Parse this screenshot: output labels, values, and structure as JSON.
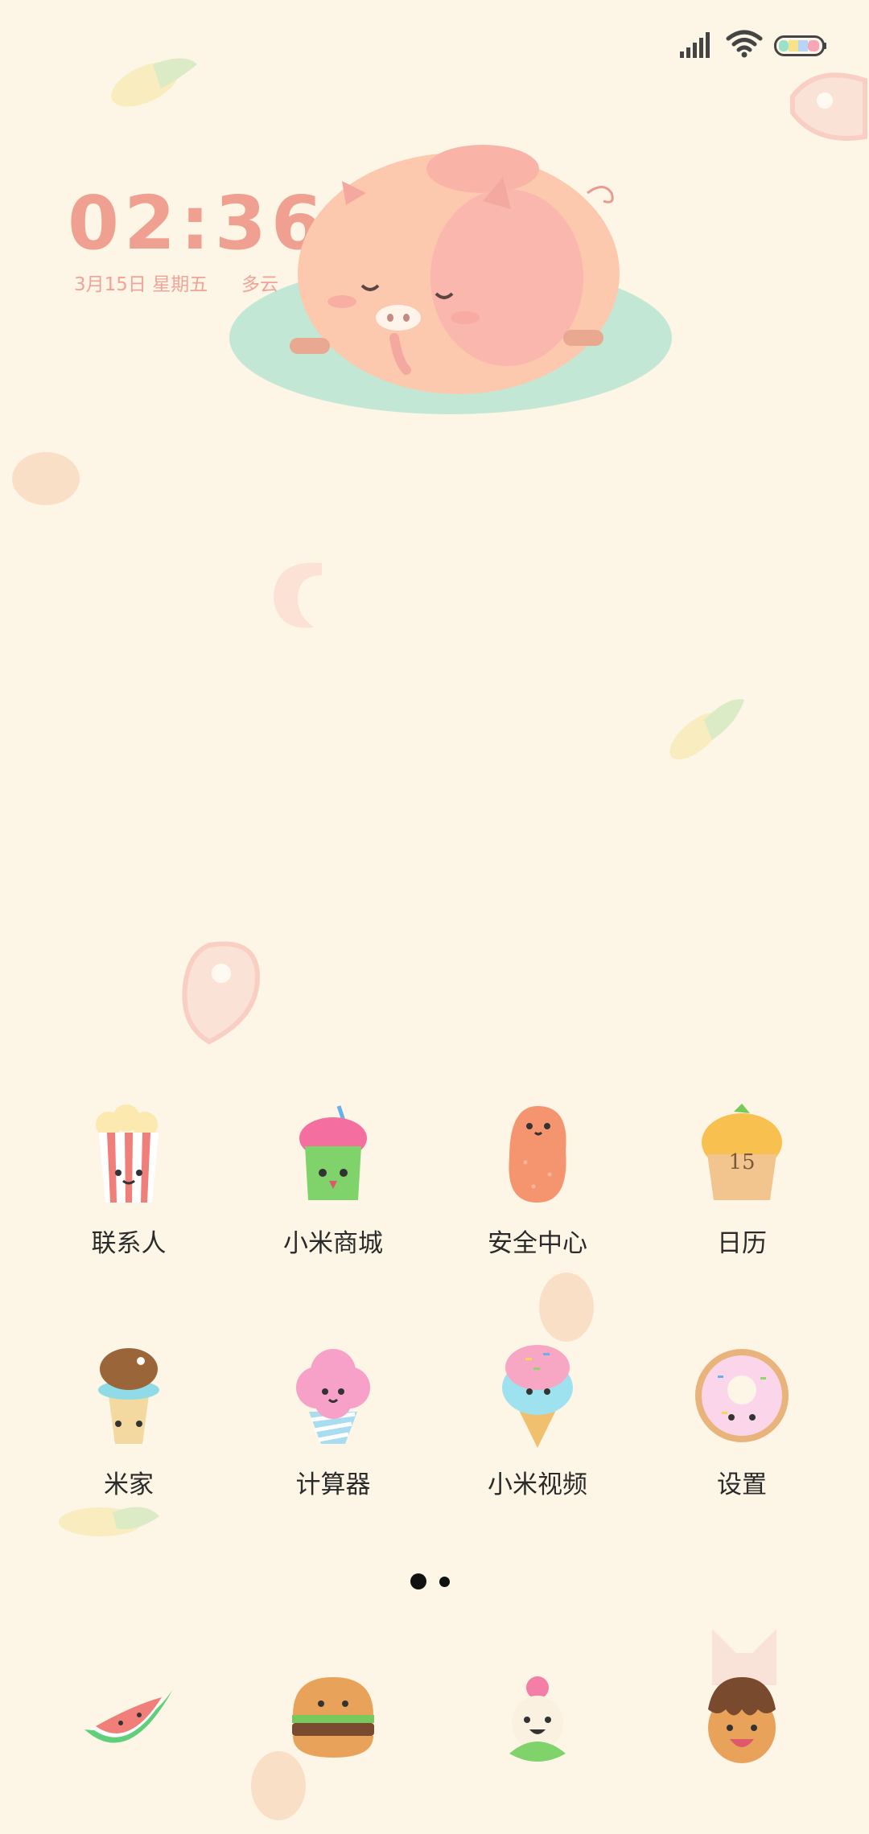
{
  "status_bar": {
    "signal_icon": "signal-bars-icon",
    "wifi_icon": "wifi-icon",
    "battery_icon": "battery-icon"
  },
  "clock": {
    "time": "02:36",
    "date": "3月15日 星期五",
    "weather": "多云"
  },
  "apps": [
    {
      "label": "联系人",
      "icon": "popcorn-icon"
    },
    {
      "label": "小米商城",
      "icon": "cupcake-icon"
    },
    {
      "label": "安全中心",
      "icon": "bean-icon"
    },
    {
      "label": "日历",
      "icon": "calendar-cupcake-icon",
      "badge": "15"
    },
    {
      "label": "米家",
      "icon": "ice-cream-cone-icon"
    },
    {
      "label": "计算器",
      "icon": "cotton-candy-icon"
    },
    {
      "label": "小米视频",
      "icon": "sprinkle-cone-icon"
    },
    {
      "label": "设置",
      "icon": "donut-icon"
    }
  ],
  "dock": [
    {
      "icon": "watermelon-icon"
    },
    {
      "icon": "burger-icon"
    },
    {
      "icon": "flower-sprout-icon"
    },
    {
      "icon": "choco-muffin-icon"
    }
  ],
  "page_indicator": {
    "pages": 2,
    "current": 1
  },
  "colors": {
    "background": "#fdf6e6",
    "clock": "#f0a090",
    "pig": "#fcc9ae",
    "puddle": "#aee3cf"
  }
}
